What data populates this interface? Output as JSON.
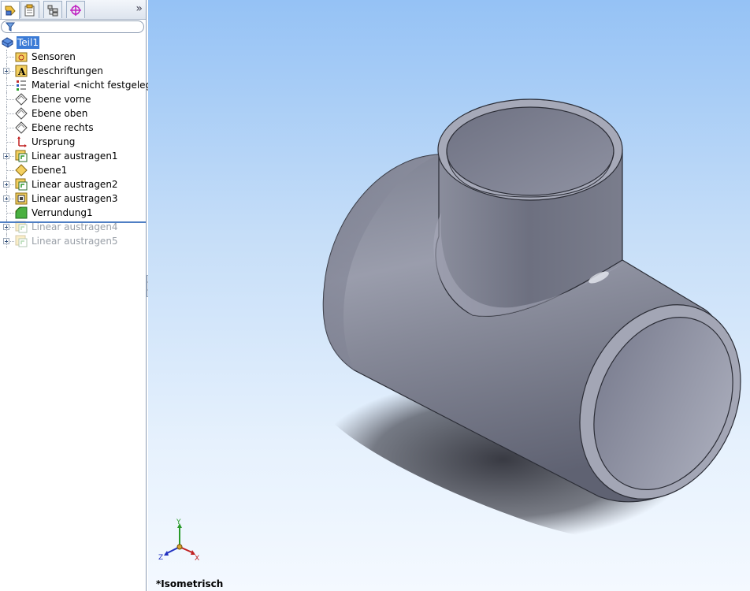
{
  "feature_manager": {
    "tabs": [
      {
        "name": "feature-manager-tab",
        "active": true
      },
      {
        "name": "property-manager-tab",
        "active": false
      },
      {
        "name": "configuration-manager-tab",
        "active": false
      },
      {
        "name": "dimxpert-manager-tab",
        "active": false
      }
    ],
    "expand_glyph": "»",
    "root": {
      "label": "Teil1",
      "icon": "part-icon"
    },
    "items": [
      {
        "label": "Sensoren",
        "icon": "sensor-folder-icon",
        "expandable": false,
        "suppressed": false
      },
      {
        "label": "Beschriftungen",
        "icon": "annotations-icon",
        "expandable": true,
        "suppressed": false
      },
      {
        "label": "Material <nicht festgelegt>",
        "icon": "material-icon",
        "expandable": false,
        "suppressed": false
      },
      {
        "label": "Ebene vorne",
        "icon": "plane-icon",
        "expandable": false,
        "suppressed": false
      },
      {
        "label": "Ebene oben",
        "icon": "plane-icon",
        "expandable": false,
        "suppressed": false
      },
      {
        "label": "Ebene rechts",
        "icon": "plane-icon",
        "expandable": false,
        "suppressed": false
      },
      {
        "label": "Ursprung",
        "icon": "origin-icon",
        "expandable": false,
        "suppressed": false
      },
      {
        "label": "Linear austragen1",
        "icon": "extrude-icon",
        "expandable": true,
        "suppressed": false
      },
      {
        "label": "Ebene1",
        "icon": "reference-plane-icon",
        "expandable": false,
        "suppressed": false
      },
      {
        "label": "Linear austragen2",
        "icon": "extrude-icon",
        "expandable": true,
        "suppressed": false
      },
      {
        "label": "Linear austragen3",
        "icon": "extrude-cut-icon",
        "expandable": true,
        "suppressed": false
      },
      {
        "label": "Verrundung1",
        "icon": "fillet-icon",
        "expandable": false,
        "suppressed": false
      },
      {
        "label": "Linear austragen4",
        "icon": "extrude-icon",
        "expandable": true,
        "suppressed": true
      },
      {
        "label": "Linear austragen5",
        "icon": "extrude-icon",
        "expandable": true,
        "suppressed": true
      }
    ]
  },
  "viewport": {
    "view_name": "*Isometrisch",
    "triad": {
      "x_label": "X",
      "y_label": "Y",
      "z_label": "Z"
    },
    "model_color": "#8a8d9c",
    "colors": {
      "accent_selection": "#3b7bd6",
      "rollback_bar": "#4f7fc4"
    }
  }
}
